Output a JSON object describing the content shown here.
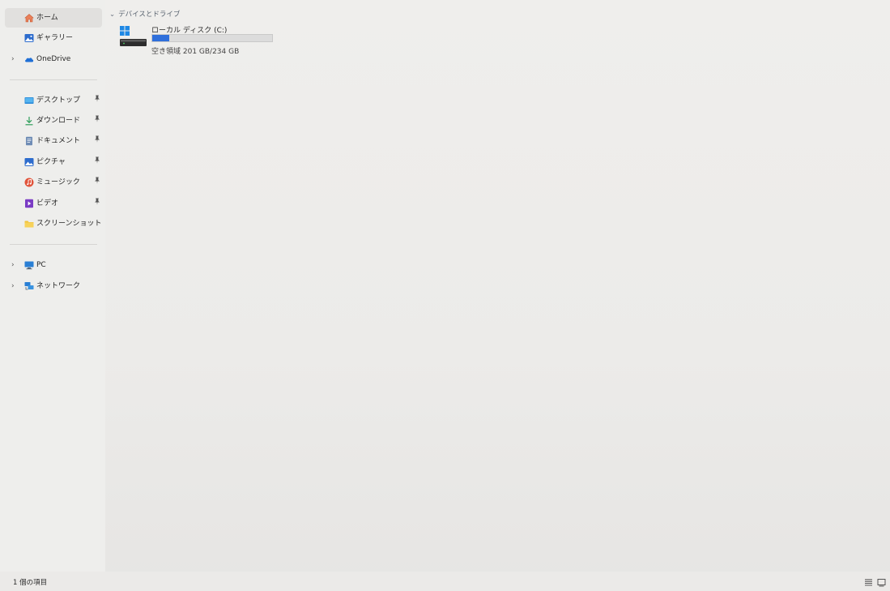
{
  "sidebar": {
    "home": {
      "label": "ホーム",
      "icon": "home-icon"
    },
    "gallery": {
      "label": "ギャラリー",
      "icon": "gallery-icon"
    },
    "onedrive": {
      "label": "OneDrive",
      "icon": "onedrive-icon",
      "chevron": "›"
    },
    "quick_access": [
      {
        "label": "デスクトップ",
        "icon": "desktop-icon",
        "pinned": true
      },
      {
        "label": "ダウンロード",
        "icon": "download-icon",
        "pinned": true
      },
      {
        "label": "ドキュメント",
        "icon": "documents-icon",
        "pinned": true
      },
      {
        "label": "ピクチャ",
        "icon": "pictures-icon",
        "pinned": true
      },
      {
        "label": "ミュージック",
        "icon": "music-icon",
        "pinned": true
      },
      {
        "label": "ビデオ",
        "icon": "videos-icon",
        "pinned": true
      },
      {
        "label": "スクリーンショット",
        "icon": "folder-icon",
        "pinned": false
      }
    ],
    "pc": {
      "label": "PC",
      "icon": "pc-icon",
      "chevron": "›"
    },
    "network": {
      "label": "ネットワーク",
      "icon": "network-icon",
      "chevron": "›"
    },
    "pin_glyph": "📌"
  },
  "main": {
    "group_header": {
      "chevron": "⌄",
      "label": "デバイスとドライブ"
    },
    "drive": {
      "name": "ローカル ディスク (C:)",
      "free_text": "空き領域 201 GB/234 GB",
      "used_fraction": 0.14,
      "bar_color": "#2f6fdb"
    }
  },
  "statusbar": {
    "item_count": "1 個の項目",
    "details_view_icon": "details-view-icon",
    "tiles_view_icon": "tiles-view-icon"
  },
  "colors": {
    "accent": "#2f6fdb",
    "selected_bg": "#e1e0de"
  }
}
